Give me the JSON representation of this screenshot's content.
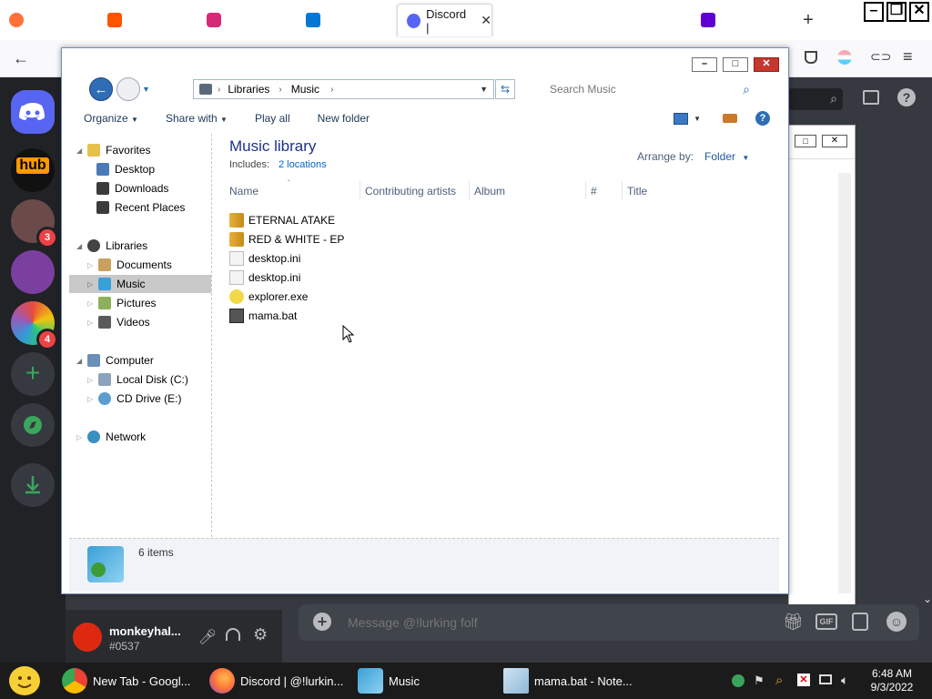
{
  "firefox": {
    "tabs": [
      {
        "name": "tab-firefox",
        "icon": "firefox-icon",
        "color": "#ff7139",
        "title": ""
      },
      {
        "name": "tab-soundcloud",
        "icon": "soundcloud-icon",
        "color": "#ff5500",
        "title": ""
      },
      {
        "name": "tab-instagram",
        "icon": "instagram-icon",
        "color": "#d62976",
        "title": ""
      },
      {
        "name": "tab-outlook",
        "icon": "outlook-icon",
        "color": "#0078d4",
        "title": ""
      },
      {
        "name": "tab-discord",
        "icon": "discord-icon",
        "color": "#5865f2",
        "title": "Discord |"
      },
      {
        "name": "tab-yahoo",
        "icon": "yahoo-icon",
        "color": "#6001d2",
        "title": ""
      }
    ],
    "close_tab": "✕",
    "new_tab": "+"
  },
  "discord": {
    "servers": [
      {
        "name": "server-discord-home",
        "color": "#5865f2",
        "badge": ""
      },
      {
        "name": "server-hub",
        "color": "#1a1a1a",
        "badge": ""
      },
      {
        "name": "server-anime-1",
        "color": "#6b4a4a",
        "badge": "3"
      },
      {
        "name": "server-anime-2",
        "color": "#7b3fa0",
        "badge": ""
      },
      {
        "name": "server-colorful",
        "color": "#2a6e9e",
        "badge": "4"
      }
    ],
    "user": {
      "name": "monkeyhal...",
      "tag": "#0537"
    },
    "message_placeholder": "Message @!lurking folf"
  },
  "explorer": {
    "breadcrumb": [
      "Libraries",
      "Music"
    ],
    "search_placeholder": "Search Music",
    "toolbar": {
      "organize": "Organize",
      "share_with": "Share with",
      "play_all": "Play all",
      "new_folder": "New folder"
    },
    "nav": {
      "favorites": "Favorites",
      "desktop": "Desktop",
      "downloads": "Downloads",
      "recent_places": "Recent Places",
      "libraries": "Libraries",
      "documents": "Documents",
      "music": "Music",
      "pictures": "Pictures",
      "videos": "Videos",
      "computer": "Computer",
      "local_disk": "Local Disk (C:)",
      "cd_drive": "CD Drive (E:)",
      "network": "Network"
    },
    "library_title": "Music library",
    "includes_label": "Includes:",
    "includes_link": "2 locations",
    "arrange_label": "Arrange by:",
    "arrange_value": "Folder",
    "columns": {
      "name": "Name",
      "artists": "Contributing artists",
      "album": "Album",
      "number": "#",
      "title": "Title"
    },
    "files": [
      {
        "name": "ETERNAL ATAKE",
        "icon": "music-folder-icon"
      },
      {
        "name": "RED & WHITE - EP",
        "icon": "music-folder-icon"
      },
      {
        "name": "desktop.ini",
        "icon": "settings-file-icon"
      },
      {
        "name": "desktop.ini",
        "icon": "settings-file-icon"
      },
      {
        "name": "explorer.exe",
        "icon": "application-icon"
      },
      {
        "name": "mama.bat",
        "icon": "batch-file-icon"
      }
    ],
    "status": "6 items"
  },
  "taskbar": {
    "items": [
      {
        "name": "taskbar-chrome",
        "label": "New Tab - Googl...",
        "color": "#4285f4"
      },
      {
        "name": "taskbar-firefox",
        "label": "Discord | @!lurkin...",
        "color": "#ff7139"
      },
      {
        "name": "taskbar-music",
        "label": "Music",
        "color": "#3aa0d8"
      },
      {
        "name": "taskbar-notepad",
        "label": "mama.bat - Note...",
        "color": "#8fb8d8"
      }
    ],
    "time": "6:48 AM",
    "date": "9/3/2022"
  }
}
